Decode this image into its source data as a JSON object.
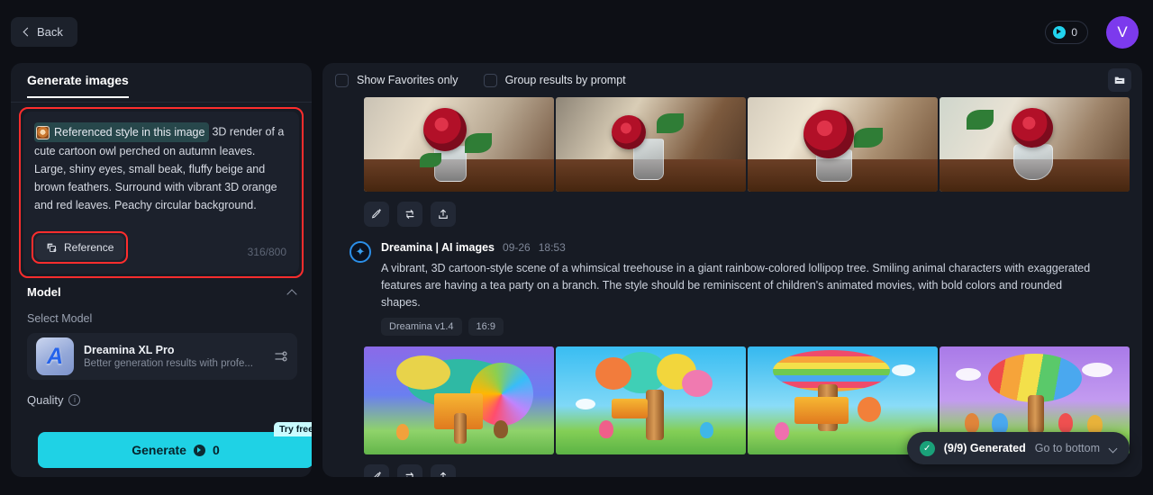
{
  "topbar": {
    "back_label": "Back",
    "back_icon": "chevron-left-icon",
    "credits_value": "0",
    "credits_icon": "coin-icon",
    "avatar_initial": "V"
  },
  "left_panel": {
    "tab_label": "Generate images",
    "prompt": {
      "reference_chip_label": "Referenced style in this image",
      "reference_thumb_icon": "owl-thumbnail",
      "text": "3D render of a cute cartoon owl perched on autumn leaves. Large, shiny eyes, small beak, fluffy beige and brown feathers. Surround with vibrant 3D orange and red leaves. Peachy circular background.",
      "reference_button_label": "Reference",
      "reference_button_icon": "add-image-icon",
      "counter": "316/800"
    },
    "model_section": {
      "title": "Model",
      "collapse_icon": "chevron-up-icon",
      "select_label": "Select Model",
      "model_name": "Dreamina XL Pro",
      "model_desc": "Better generation results with profe...",
      "model_icon_glyph": "A",
      "settings_icon": "sliders-icon"
    },
    "quality": {
      "label": "Quality",
      "info_icon": "info-icon",
      "info_glyph": "i"
    },
    "generate": {
      "label": "Generate",
      "cost": "0",
      "coin_icon": "coin-icon",
      "badge": "Try free"
    },
    "accent_highlight": "#ff2d2d",
    "accent_generate": "#1fd2e5"
  },
  "right_panel": {
    "filters": [
      {
        "label": "Show Favorites only",
        "checked": false
      },
      {
        "label": "Group results by prompt",
        "checked": false
      }
    ],
    "folder_button_icon": "folder-icon",
    "actions": [
      {
        "name": "edit",
        "icon": "pencil-icon"
      },
      {
        "name": "regenerate",
        "icon": "swap-arrows-icon"
      },
      {
        "name": "share",
        "icon": "upload-icon"
      }
    ],
    "results": [
      {
        "id": "roses",
        "images": [
          {
            "alt": "red rose in a clear glass of water on a wooden table"
          },
          {
            "alt": "red rose in a beaded crystal vase on a dark table"
          },
          {
            "alt": "dewy red rose in a faceted crystal vase"
          },
          {
            "alt": "red rose in a round glass bowl near a sofa"
          }
        ]
      },
      {
        "id": "treehouse",
        "brand": "Dreamina | AI images",
        "brand_icon": "dreamina-spark-icon",
        "date": "09-26",
        "time": "18:53",
        "prompt": "A vibrant, 3D cartoon-style scene of a whimsical treehouse in a giant rainbow-colored lollipop tree. Smiling animal characters with exaggerated features are having a tea party on a branch. The style should be reminiscent of children's animated movies, with bold colors and rounded shapes.",
        "tags": [
          "Dreamina v1.4",
          "16:9"
        ],
        "images": [
          {
            "alt": "rainbow lollipop treehouse on purple sky"
          },
          {
            "alt": "balloon-canopy tree with animal tea party"
          },
          {
            "alt": "rainbow swirl tree with orange fox character"
          },
          {
            "alt": "candy-striped tree with four animals on green hill"
          }
        ]
      }
    ],
    "status": {
      "icon": "check-circle-icon",
      "check_glyph": "✓",
      "text": "(9/9) Generated",
      "goto_label": "Go to bottom",
      "chevron_icon": "chevron-down-icon"
    }
  }
}
